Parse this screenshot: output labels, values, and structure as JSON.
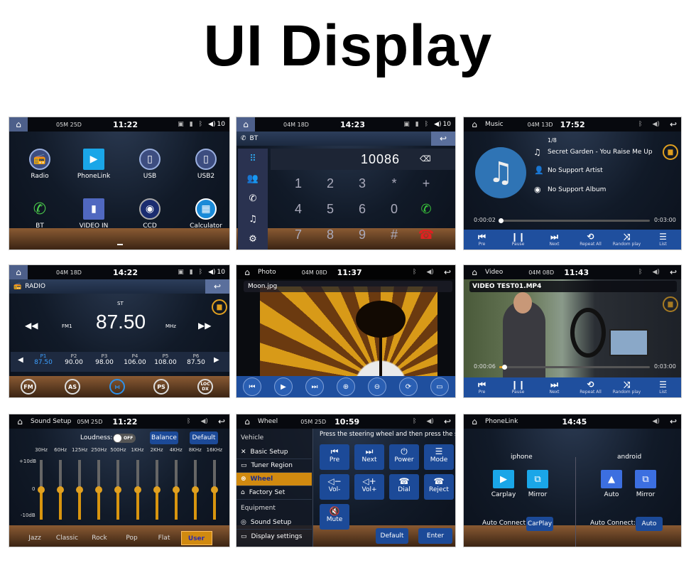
{
  "title": "UI Display",
  "home": {
    "date": "05M 25D",
    "time": "11:22",
    "volume": "10",
    "apps": [
      {
        "label": "Radio",
        "icon": "radio-icon"
      },
      {
        "label": "PhoneLink",
        "icon": "phonelink-icon"
      },
      {
        "label": "USB",
        "icon": "usb-icon"
      },
      {
        "label": "USB2",
        "icon": "usb-icon"
      },
      {
        "label": "BT",
        "icon": "phone-icon"
      },
      {
        "label": "VIDEO IN",
        "icon": "video-in-icon"
      },
      {
        "label": "CCD",
        "icon": "camera-icon"
      },
      {
        "label": "Calculator",
        "icon": "calculator-icon"
      }
    ]
  },
  "bt": {
    "date": "04M 18D",
    "time": "14:23",
    "volume": "10",
    "header": "BT",
    "dialed_number": "10086",
    "keys": [
      "1",
      "2",
      "3",
      "*",
      "+",
      "4",
      "5",
      "6",
      "0",
      "7",
      "8",
      "9",
      "#"
    ]
  },
  "music": {
    "title": "Music",
    "date": "04M 13D",
    "time": "17:52",
    "track_index": "1/8",
    "song": "Secret Garden - You Raise Me Up",
    "artist": "No Support Artist",
    "album": "No Support Album",
    "elapsed": "0:00:02",
    "duration": "0:03:00",
    "progress": 0.011,
    "controls": [
      "Pre",
      "Pause",
      "Next",
      "Repeat All",
      "Random play",
      "List"
    ]
  },
  "radio": {
    "date": "04M 18D",
    "time": "14:22",
    "volume": "10",
    "header": "RADIO",
    "stereo": "ST",
    "band": "FM1",
    "frequency": "87.50",
    "unit": "MHz",
    "presets": [
      {
        "label": "P1",
        "freq": "87.50",
        "active": true
      },
      {
        "label": "P2",
        "freq": "90.00"
      },
      {
        "label": "P3",
        "freq": "98.00"
      },
      {
        "label": "P4",
        "freq": "106.00"
      },
      {
        "label": "P5",
        "freq": "108.00"
      },
      {
        "label": "P6",
        "freq": "87.50"
      }
    ],
    "buttons": [
      "FM",
      "AS",
      "",
      "PS",
      "LOC DX"
    ]
  },
  "photo": {
    "title": "Photo",
    "date": "04M 08D",
    "time": "11:37",
    "filename": "Moon.jpg"
  },
  "video": {
    "title": "Video",
    "date": "04M 08D",
    "time": "11:43",
    "filename": "VIDEO TEST01.MP4",
    "elapsed": "0:00:06",
    "duration": "0:03:00",
    "progress": 0.033,
    "controls": [
      "Pre",
      "Pause",
      "Next",
      "Repeat All",
      "Random play",
      "List"
    ]
  },
  "sound": {
    "title": "Sound Setup",
    "date": "05M 25D",
    "time": "11:22",
    "loudness_label": "Loudness:",
    "loudness_state": "OFF",
    "balance": "Balance",
    "default": "Default",
    "db_max": "+10dB",
    "db_mid": "0",
    "db_min": "-10dB",
    "bands": [
      {
        "hz": "30Hz",
        "db": 0
      },
      {
        "hz": "60Hz",
        "db": 0
      },
      {
        "hz": "125Hz",
        "db": 0
      },
      {
        "hz": "250Hz",
        "db": 0
      },
      {
        "hz": "500Hz",
        "db": 0
      },
      {
        "hz": "1KHz",
        "db": 0
      },
      {
        "hz": "2KHz",
        "db": 0
      },
      {
        "hz": "4KHz",
        "db": 0
      },
      {
        "hz": "8KHz",
        "db": 0
      },
      {
        "hz": "16KHz",
        "db": 0
      }
    ],
    "presets": [
      "Jazz",
      "Classic",
      "Rock",
      "Pop",
      "Flat",
      "User"
    ],
    "active_preset": "User"
  },
  "wheel": {
    "title": "Wheel",
    "date": "05M 25D",
    "time": "10:59",
    "instruction": "Press the steering wheel and then press the s",
    "section_vehicle": "Vehicle",
    "section_equipment": "Equipment",
    "menu": [
      "Basic Setup",
      "Tuner Region",
      "Wheel",
      "Factory Set",
      "Sound Setup",
      "Display settings"
    ],
    "keys": [
      {
        "label": "Pre",
        "glyph": "⏮"
      },
      {
        "label": "Next",
        "glyph": "⏭"
      },
      {
        "label": "Power",
        "glyph": "⏻"
      },
      {
        "label": "Mode",
        "glyph": "☰"
      },
      {
        "label": "Vol-",
        "glyph": "◁−"
      },
      {
        "label": "Vol+",
        "glyph": "◁+"
      },
      {
        "label": "Dial",
        "glyph": "☎"
      },
      {
        "label": "Reject",
        "glyph": "☎"
      },
      {
        "label": "Mute",
        "glyph": "🔇"
      }
    ],
    "default": "Default",
    "enter": "Enter"
  },
  "phonelink": {
    "title": "PhoneLink",
    "time": "14:45",
    "iphone": "iphone",
    "android": "android",
    "carplay": "Carplay",
    "mirror": "Mirror",
    "auto": "Auto",
    "auto_connect_label": "Auto Connect:",
    "iphone_auto_value": "CarPlay",
    "android_auto_value": "Auto"
  }
}
